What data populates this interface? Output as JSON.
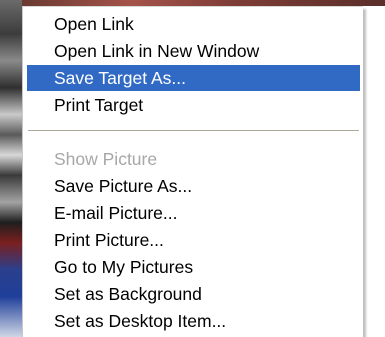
{
  "context_menu": {
    "group1": [
      {
        "label": "Open Link"
      },
      {
        "label": "Open Link in New Window"
      },
      {
        "label": "Save Target As...",
        "selected": true
      },
      {
        "label": "Print Target"
      }
    ],
    "group2": [
      {
        "label": "Show Picture",
        "disabled": true
      },
      {
        "label": "Save Picture As..."
      },
      {
        "label": "E-mail Picture..."
      },
      {
        "label": "Print Picture..."
      },
      {
        "label": "Go to My Pictures"
      },
      {
        "label": "Set as Background"
      },
      {
        "label": "Set as Desktop Item..."
      }
    ]
  },
  "colors": {
    "highlight": "#316ac5",
    "highlight_text": "#ffffff",
    "disabled_text": "#a7a7a7",
    "menu_background": "#ffffff"
  }
}
